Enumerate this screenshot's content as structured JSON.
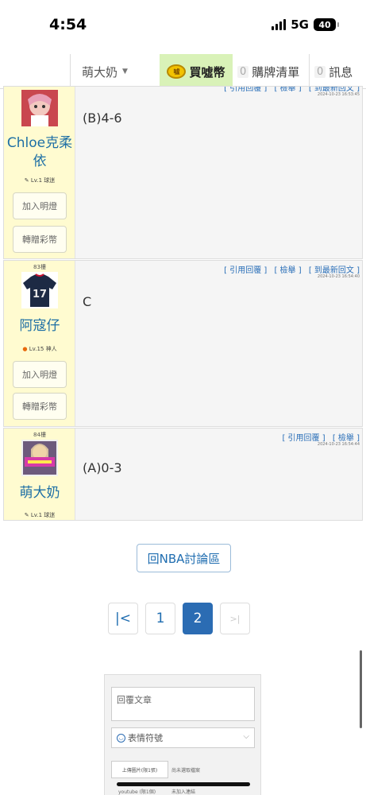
{
  "status_bar": {
    "time": "4:54",
    "network": "5G",
    "battery": "40"
  },
  "nav": {
    "user": "萌大奶",
    "buy_label": "買噓幣",
    "coin_icon_text": "噓",
    "cart_count": "0",
    "cart_label": "購牌清單",
    "msg_count": "0",
    "msg_label": "訊息"
  },
  "posts": [
    {
      "floor": "",
      "username": "Chloe克柔依",
      "level": "Lv.1 球迷",
      "level_icon": "pencil-icon",
      "buttons": [
        "加入明燈",
        "轉贈彩幣"
      ],
      "actions": [
        "[ 引用回覆 ]",
        "[ 檢舉 ]",
        "[ 到最新回文 ]"
      ],
      "time": "2024-10-23 16:53:45",
      "content": "(B)4-6"
    },
    {
      "floor": "83樓",
      "username": "阿寇仔",
      "level": "Lv.15 神人",
      "level_icon": "fire-badge-icon",
      "buttons": [
        "加入明燈",
        "轉贈彩幣"
      ],
      "actions": [
        "[ 引用回覆 ]",
        "[ 檢舉 ]",
        "[ 到最新回文 ]"
      ],
      "time": "2024-10-23 16:54:40",
      "content": "C",
      "jersey_number": "17"
    },
    {
      "floor": "84樓",
      "username": "萌大奶",
      "level": "Lv.1 球迷",
      "level_icon": "pencil-icon",
      "actions": [
        "[ 引用回覆 ]",
        "[ 檢舉 ]"
      ],
      "time": "2024-10-23 16:54:44",
      "content": "(A)0-3"
    }
  ],
  "back_button": "回NBA討論區",
  "pagination": {
    "first": "|<",
    "pages": [
      "1",
      "2"
    ],
    "current": "2",
    "last": ">|"
  },
  "reply_form": {
    "placeholder": "回覆文章",
    "emoji_label": "表情符號",
    "upload_label": "上傳圖片(限1張)",
    "upload_status": "尚未選取檔案",
    "youtube_label": "youtube (限1個)",
    "youtube_status": "未加入連結"
  },
  "colors": {
    "accent": "#2b6cb3",
    "user_panel": "#fffbd0",
    "buy_highlight": "#d9f2b8",
    "username": "#1d6fa5"
  }
}
